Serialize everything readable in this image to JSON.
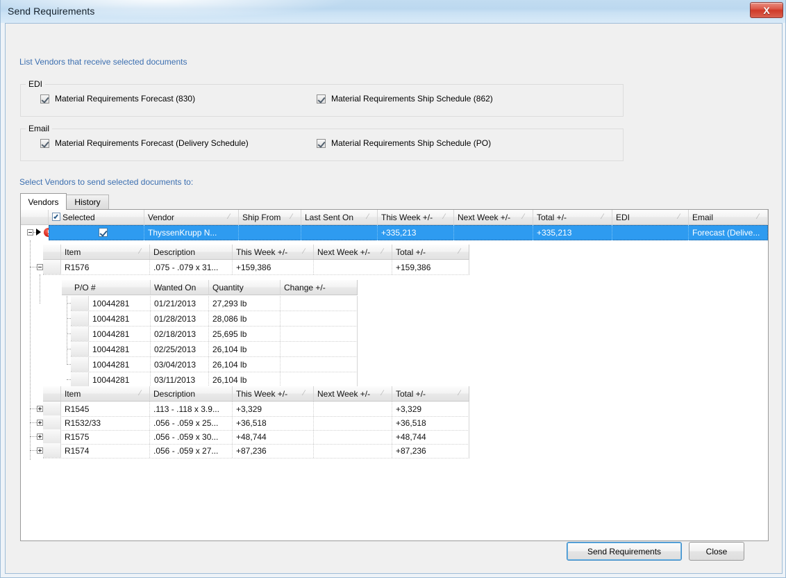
{
  "window": {
    "title": "Send Requirements",
    "close_icon": "close-icon",
    "close_label": "X"
  },
  "intro_label": "List Vendors that receive selected documents",
  "groups": [
    {
      "title": "EDI",
      "checkboxes": [
        {
          "label": "Material Requirements Forecast (830)",
          "checked": true
        },
        {
          "label": "Material Requirements Ship Schedule (862)",
          "checked": true
        }
      ]
    },
    {
      "title": "Email",
      "checkboxes": [
        {
          "label": "Material Requirements Forecast (Delivery Schedule)",
          "checked": true
        },
        {
          "label": "Material Requirements Ship Schedule (PO)",
          "checked": true
        }
      ]
    }
  ],
  "select_vendors_label": "Select Vendors to send selected documents to:",
  "tabs": [
    {
      "label": "Vendors",
      "active": true
    },
    {
      "label": "History",
      "active": false
    }
  ],
  "vendor_grid": {
    "columns": [
      "Selected",
      "Vendor",
      "Ship From",
      "Last Sent On",
      "This Week +/-",
      "Next Week +/-",
      "Total +/-",
      "EDI",
      "Email"
    ],
    "header_checkbox_checked": true,
    "rows": [
      {
        "selected": true,
        "vendor": "ThyssenKrupp  N...",
        "ship_from": "",
        "last_sent_on": "",
        "this_week": "+335,213",
        "next_week": "",
        "total": "+335,213",
        "edi": "",
        "email": "Forecast  (Delive...",
        "has_error": true,
        "expanded": true,
        "is_current": true
      }
    ]
  },
  "item_grid_top": {
    "columns": [
      "Item",
      "Description",
      "This Week +/-",
      "Next Week +/-",
      "Total +/-"
    ],
    "rows": [
      {
        "item": "R1576",
        "description": ".075 -  .079 x 31...",
        "this_week": "+159,386",
        "next_week": "",
        "total": "+159,386",
        "expanded": true
      }
    ]
  },
  "po_grid": {
    "columns": [
      "P/O #",
      "Wanted On",
      "Quantity",
      "Change +/-"
    ],
    "rows": [
      {
        "po": "10044281",
        "wanted_on": "01/21/2013",
        "quantity": "27,293 lb",
        "change": ""
      },
      {
        "po": "10044281",
        "wanted_on": "01/28/2013",
        "quantity": "28,086 lb",
        "change": ""
      },
      {
        "po": "10044281",
        "wanted_on": "02/18/2013",
        "quantity": "25,695 lb",
        "change": ""
      },
      {
        "po": "10044281",
        "wanted_on": "02/25/2013",
        "quantity": "26,104 lb",
        "change": ""
      },
      {
        "po": "10044281",
        "wanted_on": "03/04/2013",
        "quantity": "26,104 lb",
        "change": ""
      },
      {
        "po": "10044281",
        "wanted_on": "03/11/2013",
        "quantity": "26,104 lb",
        "change": ""
      }
    ]
  },
  "item_grid_bottom": {
    "columns": [
      "Item",
      "Description",
      "This Week +/-",
      "Next Week +/-",
      "Total +/-"
    ],
    "rows": [
      {
        "item": "R1545",
        "description": ".113 -  .118 x 3.9...",
        "this_week": "+3,329",
        "next_week": "",
        "total": "+3,329",
        "expanded": false
      },
      {
        "item": "R1532/33",
        "description": ".056 -  .059   x 25...",
        "this_week": "+36,518",
        "next_week": "",
        "total": "+36,518",
        "expanded": false
      },
      {
        "item": "R1575",
        "description": ".056 -  .059 x 30...",
        "this_week": "+48,744",
        "next_week": "",
        "total": "+48,744",
        "expanded": false
      },
      {
        "item": "R1574",
        "description": ".056 -  .059 x 27...",
        "this_week": "+87,236",
        "next_week": "",
        "total": "+87,236",
        "expanded": false
      }
    ]
  },
  "footer": {
    "send_label": "Send Requirements",
    "close_label": "Close"
  },
  "colors": {
    "accent_blue": "#3c6fb0",
    "selection_blue": "#2e9bf0",
    "error_red": "#d8271a",
    "title_gradient_top": "#c2dcf1"
  }
}
